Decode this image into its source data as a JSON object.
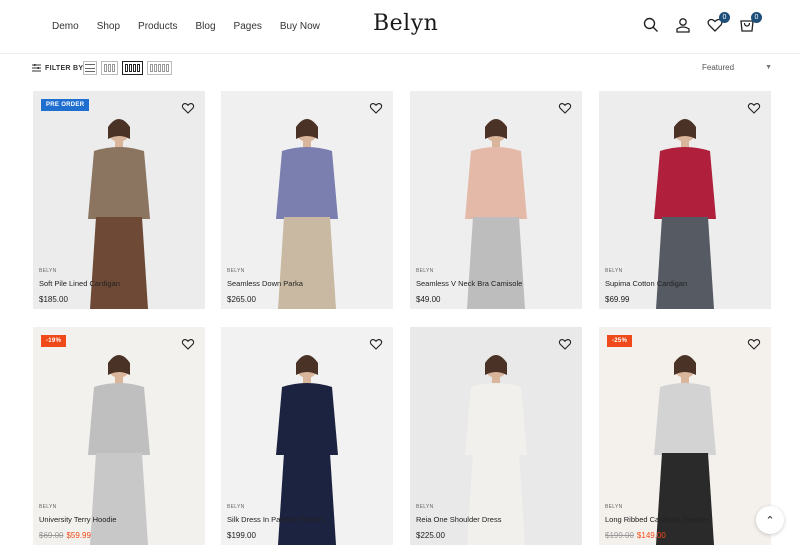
{
  "header": {
    "nav": [
      "Demo",
      "Shop",
      "Products",
      "Blog",
      "Pages",
      "Buy Now"
    ],
    "logo": "Belyn",
    "wishlist_count": "0",
    "cart_count": "0"
  },
  "toolbar": {
    "filter_label": "FILTER BY",
    "sort_value": "Featured"
  },
  "products": [
    {
      "brand": "BELYN",
      "name": "Soft Pile Lined Cardigan",
      "price": "$185.00",
      "tag": "PRE ORDER",
      "bg": "#ececec",
      "top": "#8b7460",
      "bottom": "#6e4a36"
    },
    {
      "brand": "BELYN",
      "name": "Seamless Down Parka",
      "price": "$265.00",
      "tag": "",
      "bg": "#f0f0f0",
      "top": "#7a7fb0",
      "bottom": "#c9b9a2"
    },
    {
      "brand": "BELYN",
      "name": "Seamless V Neck Bra Camisole",
      "price": "$49.00",
      "tag": "",
      "bg": "#eeeeee",
      "top": "#e5b9a8",
      "bottom": "#bdbdbd"
    },
    {
      "brand": "BELYN",
      "name": "Supima Cotton Cardigan",
      "price": "$69.99",
      "tag": "",
      "bg": "#ededed",
      "top": "#b01f3c",
      "bottom": "#555a63"
    },
    {
      "brand": "BELYN",
      "name": "University Terry Hoodie",
      "old_price": "$69.00",
      "price": "$59.99",
      "tag": "-19%",
      "bg": "#f3f1ee",
      "top": "#bfbfbf",
      "bottom": "#c8c8c8"
    },
    {
      "brand": "BELYN",
      "name": "Silk Dress In Painted Flowers",
      "price": "$199.00",
      "tag": "",
      "bg": "#f2f2f2",
      "top": "#1c2340",
      "bottom": "#1c2340"
    },
    {
      "brand": "BELYN",
      "name": "Reia One Shoulder Dress",
      "price": "$225.00",
      "tag": "",
      "bg": "#e9e9e9",
      "top": "#f2f0ec",
      "bottom": "#f2f0ec"
    },
    {
      "brand": "BELYN",
      "name": "Long Ribbed Cardigan Sweater",
      "old_price": "$199.00",
      "price": "$149.00",
      "tag": "-25%",
      "bg": "#f4f1ed",
      "top": "#d3d3d3",
      "bottom": "#2a2a2a"
    }
  ]
}
